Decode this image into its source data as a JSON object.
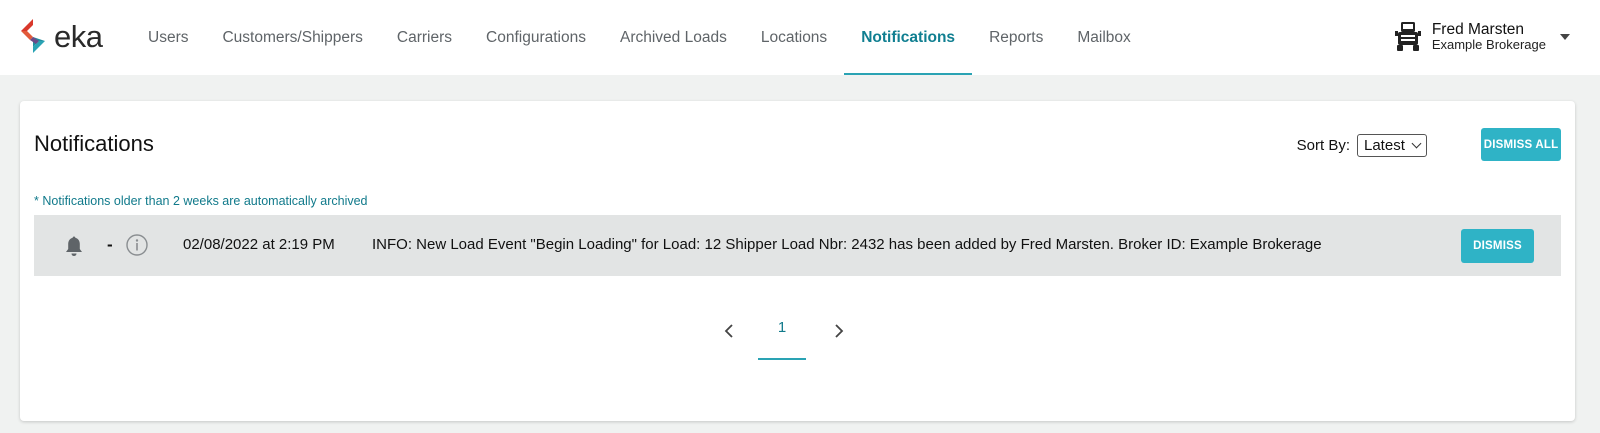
{
  "brand": {
    "name": "eka"
  },
  "nav": {
    "items": [
      {
        "label": "Users"
      },
      {
        "label": "Customers/Shippers"
      },
      {
        "label": "Carriers"
      },
      {
        "label": "Configurations"
      },
      {
        "label": "Archived Loads"
      },
      {
        "label": "Locations"
      },
      {
        "label": "Notifications",
        "active": true
      },
      {
        "label": "Reports"
      },
      {
        "label": "Mailbox"
      }
    ]
  },
  "user": {
    "name": "Fred Marsten",
    "org": "Example Brokerage",
    "icon": "truck-icon"
  },
  "page": {
    "title": "Notifications",
    "sort_label": "Sort By:",
    "sort_value": "Latest",
    "dismiss_all_label": "DISMISS ALL",
    "archive_note": "* Notifications older than 2 weeks are automatically archived"
  },
  "notifications": [
    {
      "icon": "bell-icon",
      "separator": "-",
      "type_icon": "info-icon",
      "date": "02/08/2022 at 2:19 PM",
      "message": "INFO: New Load Event \"Begin Loading\" for Load: 12 Shipper Load Nbr: 2432 has been added by Fred Marsten. Broker ID: Example Brokerage",
      "dismiss_label": "DISMISS"
    }
  ],
  "pagination": {
    "current_page": "1"
  },
  "colors": {
    "accent": "#2fb3c6",
    "accent_text": "#117a8b",
    "row_bg": "#e2e4e4",
    "page_bg": "#f0f2f1",
    "logo_red": "#d9382b",
    "logo_teal": "#1f8e9f"
  }
}
